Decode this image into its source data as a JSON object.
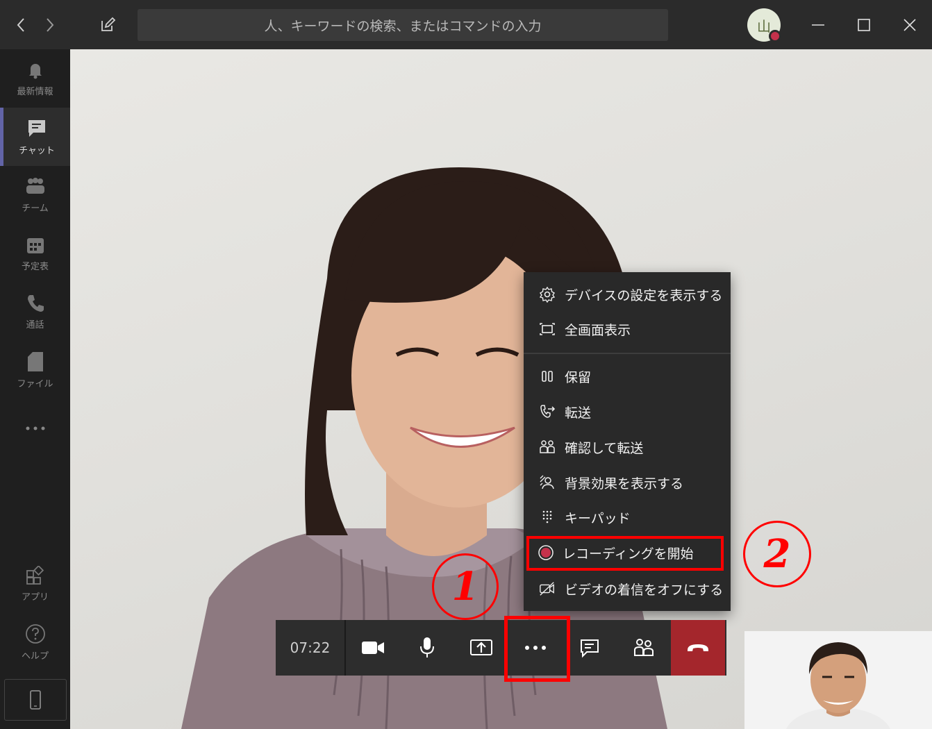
{
  "titlebar": {
    "search_placeholder": "人、キーワードの検索、またはコマンドの入力",
    "avatar_initial": "山",
    "icons": [
      "chevron-left-icon",
      "chevron-right-icon",
      "compose-icon",
      "minimize-icon",
      "maximize-icon",
      "close-icon"
    ]
  },
  "sidebar": {
    "items": [
      {
        "label": "最新情報",
        "icon": "bell-icon"
      },
      {
        "label": "チャット",
        "icon": "chat-icon",
        "active": true
      },
      {
        "label": "チーム",
        "icon": "teams-icon"
      },
      {
        "label": "予定表",
        "icon": "calendar-icon"
      },
      {
        "label": "通話",
        "icon": "phone-icon"
      },
      {
        "label": "ファイル",
        "icon": "file-icon"
      },
      {
        "label": "アプリ",
        "icon": "apps-icon"
      },
      {
        "label": "ヘルプ",
        "icon": "help-icon"
      }
    ]
  },
  "menu": {
    "items": [
      {
        "label": "デバイスの設定を表示する",
        "icon": "gear-icon"
      },
      {
        "label": "全画面表示",
        "icon": "fullscreen-icon"
      },
      {
        "label": "保留",
        "icon": "pause-icon"
      },
      {
        "label": "転送",
        "icon": "transfer-icon"
      },
      {
        "label": "確認して転送",
        "icon": "consult-transfer-icon"
      },
      {
        "label": "背景効果を表示する",
        "icon": "background-effects-icon"
      },
      {
        "label": "キーパッド",
        "icon": "keypad-icon"
      },
      {
        "label": "レコーディングを開始",
        "icon": "record-icon"
      },
      {
        "label": "ビデオの着信をオフにする",
        "icon": "video-off-icon"
      }
    ]
  },
  "callbar": {
    "timer": "07:22",
    "buttons": [
      "camera-icon",
      "microphone-icon",
      "share-screen-icon",
      "more-options-icon",
      "chat-icon",
      "participants-icon",
      "hangup-icon"
    ]
  },
  "annotations": {
    "step1": "1",
    "step2": "2",
    "highlight_color": "#ff0000"
  },
  "colors": {
    "accent": "#6264a7",
    "hangup": "#a4262c",
    "record": "#c4314b"
  }
}
